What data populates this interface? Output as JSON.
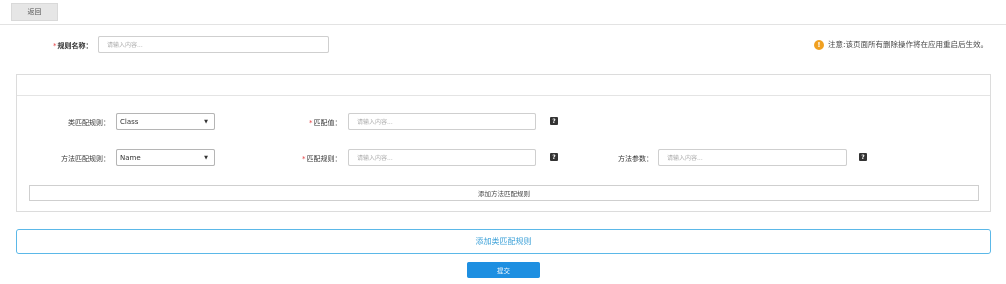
{
  "toolbar": {
    "back_label": "返回"
  },
  "rule_name": {
    "required_mark": "*",
    "label": "规则名称：",
    "placeholder": "请输入内容..."
  },
  "notice": {
    "icon": "warning-icon",
    "icon_glyph": "!",
    "text": "注意:该页面所有删除操作将在应用重启后生效。"
  },
  "class_rule": {
    "label": "类匹配规则：",
    "selected": "Class",
    "match_value": {
      "required_mark": "*",
      "label": "匹配值：",
      "placeholder": "请输入内容..."
    },
    "help_glyph": "?"
  },
  "method_rule": {
    "label": "方法匹配规则：",
    "selected": "Name",
    "match_rule": {
      "required_mark": "*",
      "label": "匹配规则：",
      "placeholder": "请输入内容..."
    },
    "params": {
      "label": "方法参数：",
      "placeholder": "请输入内容..."
    },
    "help_glyph": "?"
  },
  "buttons": {
    "add_method_rule": "添加方法匹配规则",
    "add_class_rule": "添加类匹配规则",
    "submit": "提交"
  },
  "colors": {
    "primary": "#1e8fe1",
    "outline_accent": "#5bb8e8",
    "required": "#e4393c",
    "warning": "#f0a020"
  }
}
